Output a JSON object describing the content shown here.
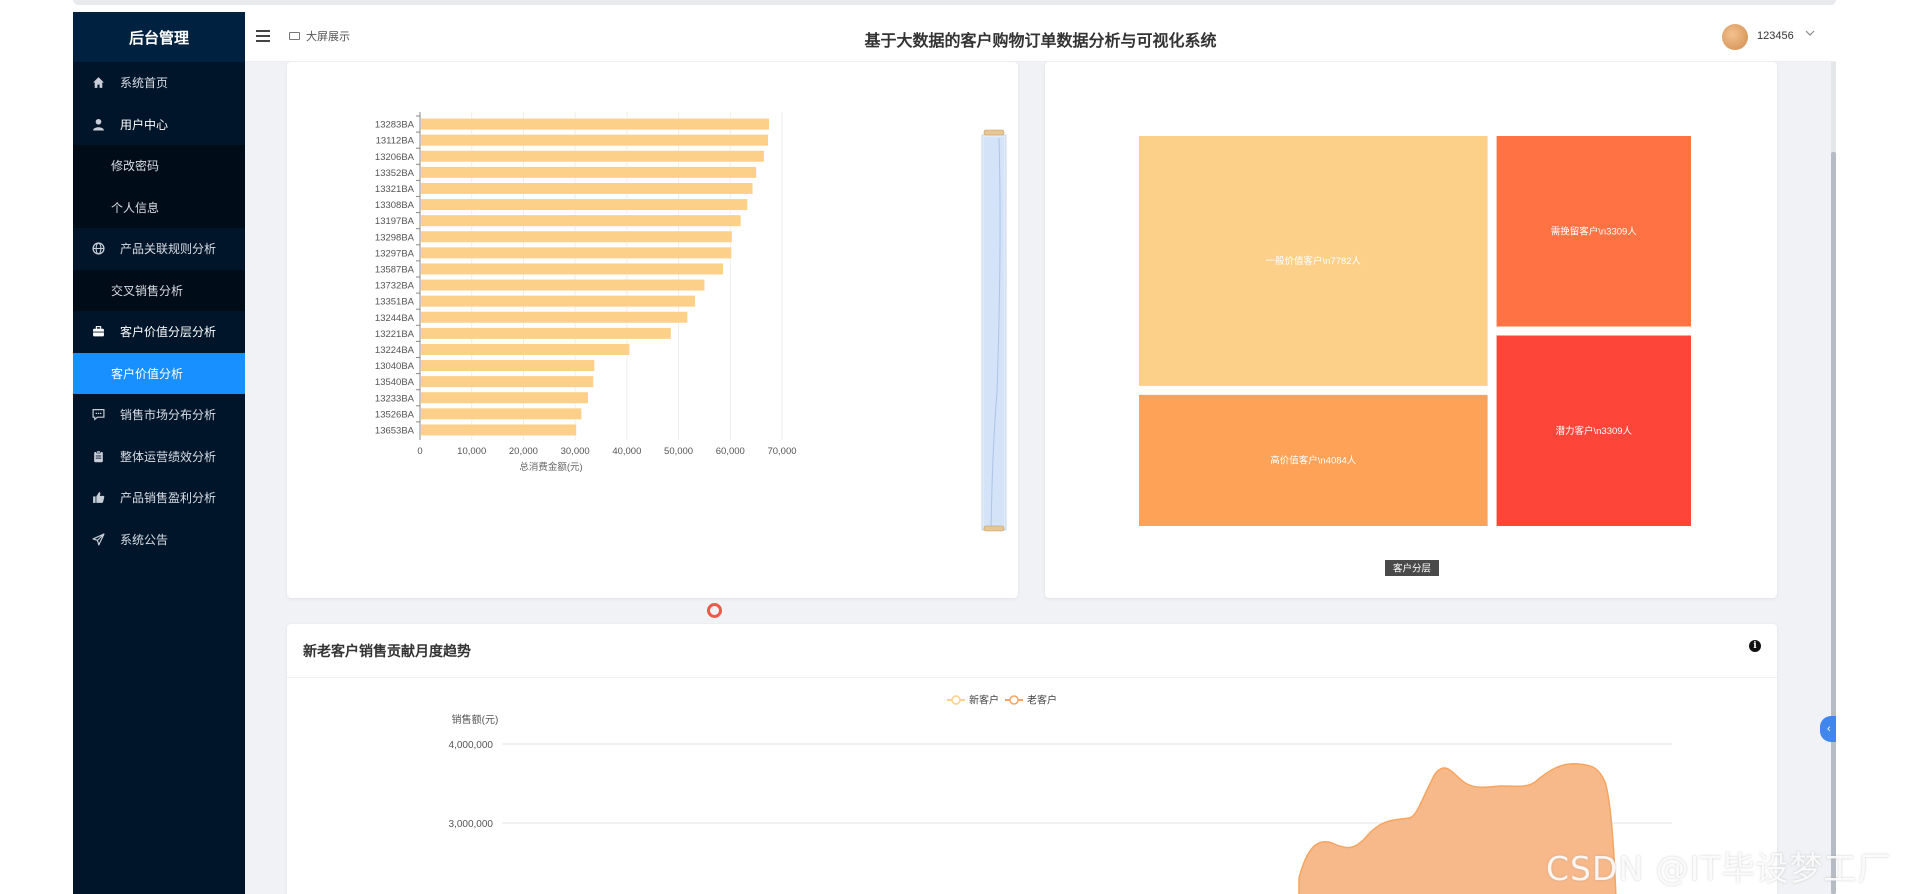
{
  "sidebar": {
    "brand": "后台管理",
    "items": [
      {
        "label": "系统首页",
        "icon": "home-icon"
      },
      {
        "label": "用户中心",
        "icon": "user-icon"
      },
      {
        "label": "修改密码"
      },
      {
        "label": "个人信息"
      },
      {
        "label": "产品关联规则分析",
        "icon": "globe-icon"
      },
      {
        "label": "交叉销售分析"
      },
      {
        "label": "客户价值分层分析",
        "icon": "briefcase-icon"
      },
      {
        "label": "客户价值分析"
      },
      {
        "label": "销售市场分布分析",
        "icon": "chat-icon"
      },
      {
        "label": "整体运营绩效分析",
        "icon": "clipboard-icon"
      },
      {
        "label": "产品销售盈利分析",
        "icon": "thumbs-up-icon"
      },
      {
        "label": "系统公告",
        "icon": "send-icon"
      }
    ],
    "accent": "#1890ff",
    "background": "#001529"
  },
  "header": {
    "bigscreen_label": "大屏展示",
    "title": "基于大数据的客户购物订单数据分析与可视化系统",
    "username": "123456"
  },
  "trend": {
    "title": "新老客户销售贡献月度趋势"
  },
  "watermark": "CSDN @IT毕设梦工厂",
  "chart_data": [
    {
      "type": "bar",
      "orientation": "horizontal",
      "categories": [
        "13283BA",
        "13112BA",
        "13206BA",
        "13352BA",
        "13321BA",
        "13308BA",
        "13197BA",
        "13298BA",
        "13297BA",
        "13587BA",
        "13732BA",
        "13351BA",
        "13244BA",
        "13221BA",
        "13224BA",
        "13040BA",
        "13540BA",
        "13233BA",
        "13526BA",
        "13653BA"
      ],
      "values": [
        67500,
        67300,
        66500,
        65000,
        64300,
        63300,
        62000,
        60300,
        60200,
        58600,
        55000,
        53200,
        51700,
        48500,
        40500,
        33700,
        33500,
        32500,
        31200,
        30200
      ],
      "xlabel": "总消费金额(元)",
      "x_ticks": [
        0,
        10000,
        20000,
        30000,
        40000,
        50000,
        60000,
        70000
      ],
      "x_tick_labels": [
        "0",
        "10,000",
        "20,000",
        "30,000",
        "40,000",
        "50,000",
        "60,000",
        "70,000"
      ],
      "xlim": [
        0,
        70000
      ],
      "bar_color": "#fcd088",
      "grid": true,
      "datazoom": "right-vertical"
    },
    {
      "type": "treemap",
      "items": [
        {
          "label": "一般价值客户\\n7782人",
          "value": 7782,
          "color": "#fdd089"
        },
        {
          "label": "高价值客户\\n4084人",
          "value": 4084,
          "color": "#fea257"
        },
        {
          "label": "需挽留客户\\n3309人",
          "value": 3309,
          "color": "#fe7244"
        },
        {
          "label": "潜力客户\\n3309人",
          "value": 3309,
          "color": "#fe453a"
        }
      ],
      "breadcrumb": "客户分层"
    },
    {
      "type": "area",
      "legend": [
        "新客户",
        "老客户"
      ],
      "legend_position": "top-center",
      "ylabel": "销售额(元)",
      "y_ticks_visible": [
        "4,000,000",
        "3,000,000"
      ],
      "colors": [
        "#fcd088",
        "#f6a45f"
      ]
    }
  ]
}
